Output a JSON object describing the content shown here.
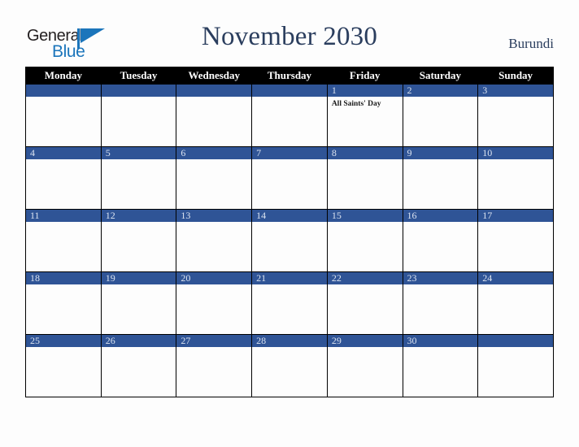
{
  "brand": {
    "name_top": "General",
    "name_bottom": "Blue",
    "triangle_icon": "triangle-logo-mark",
    "color_primary": "#1b75bb",
    "color_text": "#231f20"
  },
  "header": {
    "title": "November 2030",
    "country": "Burundi",
    "title_color": "#2b3e5e"
  },
  "calendar": {
    "month": "November",
    "year": "2030",
    "week_start": "Monday",
    "header_bg": "#000000",
    "daynum_bg": "#2f5496",
    "daynum_color": "#dbe3f0",
    "weekdays": [
      "Monday",
      "Tuesday",
      "Wednesday",
      "Thursday",
      "Friday",
      "Saturday",
      "Sunday"
    ],
    "weeks": [
      [
        {
          "day": "",
          "events": []
        },
        {
          "day": "",
          "events": []
        },
        {
          "day": "",
          "events": []
        },
        {
          "day": "",
          "events": []
        },
        {
          "day": "1",
          "events": [
            "All Saints' Day"
          ]
        },
        {
          "day": "2",
          "events": []
        },
        {
          "day": "3",
          "events": []
        }
      ],
      [
        {
          "day": "4",
          "events": []
        },
        {
          "day": "5",
          "events": []
        },
        {
          "day": "6",
          "events": []
        },
        {
          "day": "7",
          "events": []
        },
        {
          "day": "8",
          "events": []
        },
        {
          "day": "9",
          "events": []
        },
        {
          "day": "10",
          "events": []
        }
      ],
      [
        {
          "day": "11",
          "events": []
        },
        {
          "day": "12",
          "events": []
        },
        {
          "day": "13",
          "events": []
        },
        {
          "day": "14",
          "events": []
        },
        {
          "day": "15",
          "events": []
        },
        {
          "day": "16",
          "events": []
        },
        {
          "day": "17",
          "events": []
        }
      ],
      [
        {
          "day": "18",
          "events": []
        },
        {
          "day": "19",
          "events": []
        },
        {
          "day": "20",
          "events": []
        },
        {
          "day": "21",
          "events": []
        },
        {
          "day": "22",
          "events": []
        },
        {
          "day": "23",
          "events": []
        },
        {
          "day": "24",
          "events": []
        }
      ],
      [
        {
          "day": "25",
          "events": []
        },
        {
          "day": "26",
          "events": []
        },
        {
          "day": "27",
          "events": []
        },
        {
          "day": "28",
          "events": []
        },
        {
          "day": "29",
          "events": []
        },
        {
          "day": "30",
          "events": []
        },
        {
          "day": "",
          "events": []
        }
      ]
    ]
  }
}
